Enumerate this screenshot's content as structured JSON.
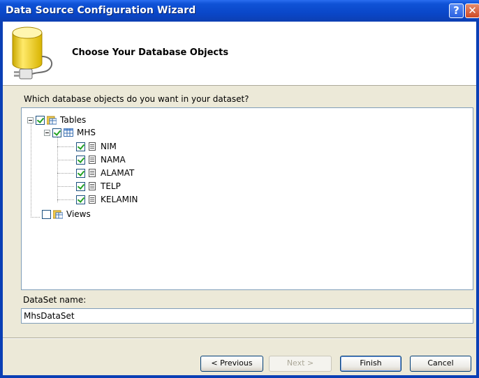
{
  "window": {
    "title": "Data Source Configuration Wizard",
    "help_button": "?",
    "close_button": "✕"
  },
  "header": {
    "heading": "Choose Your Database Objects",
    "icon": "database-plug-icon"
  },
  "prompt": "Which database objects do you want in your dataset?",
  "tree": {
    "tables": {
      "label": "Tables",
      "checked": true,
      "expanded": true
    },
    "mhs": {
      "label": "MHS",
      "checked": true,
      "expanded": true
    },
    "columns": [
      {
        "label": "NIM",
        "checked": true
      },
      {
        "label": "NAMA",
        "checked": true
      },
      {
        "label": "ALAMAT",
        "checked": true
      },
      {
        "label": "TELP",
        "checked": true
      },
      {
        "label": "KELAMIN",
        "checked": true
      }
    ],
    "views": {
      "label": "Views",
      "checked": false
    }
  },
  "dataset": {
    "label": "DataSet name:",
    "value": "MhsDataSet"
  },
  "buttons": {
    "previous": "< Previous",
    "next": "Next >",
    "finish": "Finish",
    "cancel": "Cancel"
  },
  "colors": {
    "titlebar": "#0a47c9",
    "dialog_bg": "#ece9d8",
    "checkmark": "#21a121"
  }
}
